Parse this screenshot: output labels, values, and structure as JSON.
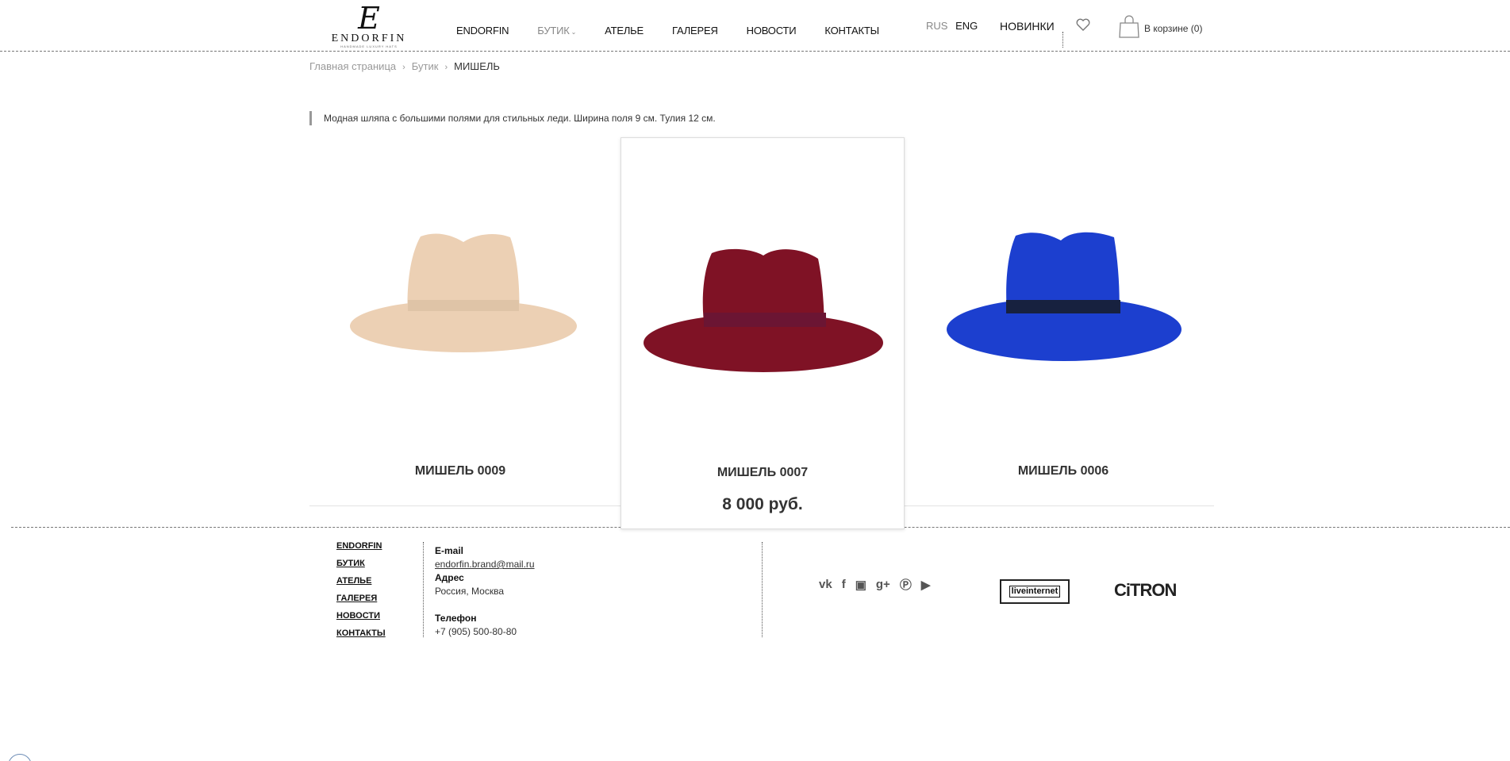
{
  "header": {
    "logo": {
      "mark": "E",
      "text": "ENDORFIN",
      "sub": "HANDMADE LUXURY HATS"
    },
    "nav": [
      {
        "label": "ENDORFIN"
      },
      {
        "label": "БУТИК"
      },
      {
        "label": "АТЕЛЬЕ"
      },
      {
        "label": "ГАЛЕРЕЯ"
      },
      {
        "label": "НОВОСТИ"
      },
      {
        "label": "КОНТАКТЫ"
      }
    ],
    "lang": {
      "rus": "RUS",
      "eng": "ENG"
    },
    "novinki": "НОВИНКИ",
    "cart": "В корзине (0)"
  },
  "breadcrumb": {
    "home": "Главная страница",
    "section": "Бутик",
    "current": "МИШЕЛЬ",
    "separator": "›"
  },
  "description": "Модная шляпа с большими полями для стильных леди. Ширина поля 9 см. Тулия 12 см.",
  "products": [
    {
      "name": "МИШЕЛЬ 0009",
      "color": "#ecd0b4",
      "band": "#ddc2a4"
    },
    {
      "name": "МИШЕЛЬ 0007",
      "price": "8 000 руб.",
      "color": "#7f1225",
      "band": "#6b1533"
    },
    {
      "name": "МИШЕЛЬ 0006",
      "color": "#1c3fcf",
      "band": "#17213f"
    }
  ],
  "footer": {
    "nav": [
      "ENDORFIN",
      "БУТИК",
      "АТЕЛЬЕ",
      "ГАЛЕРЕЯ",
      "НОВОСТИ",
      "КОНТАКТЫ"
    ],
    "email_label": "E-mail",
    "email": "endorfin.brand@mail.ru",
    "address_label": "Адрес",
    "address": "Россия, Москва",
    "phone_label": "Телефон",
    "phone": "+7 (905) 500-80-80",
    "social": [
      "vk-icon",
      "facebook-icon",
      "instagram-icon",
      "google-plus-icon",
      "pinterest-icon",
      "youtube-icon"
    ],
    "liveinternet": "liveinternet",
    "citron": "CiTRON"
  }
}
